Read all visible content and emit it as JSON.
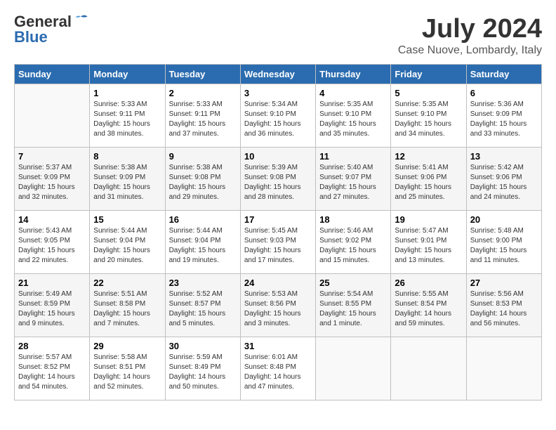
{
  "header": {
    "logo_general": "General",
    "logo_blue": "Blue",
    "month_year": "July 2024",
    "location": "Case Nuove, Lombardy, Italy"
  },
  "days_of_week": [
    "Sunday",
    "Monday",
    "Tuesday",
    "Wednesday",
    "Thursday",
    "Friday",
    "Saturday"
  ],
  "weeks": [
    [
      {
        "day": "",
        "info": ""
      },
      {
        "day": "1",
        "info": "Sunrise: 5:33 AM\nSunset: 9:11 PM\nDaylight: 15 hours\nand 38 minutes."
      },
      {
        "day": "2",
        "info": "Sunrise: 5:33 AM\nSunset: 9:11 PM\nDaylight: 15 hours\nand 37 minutes."
      },
      {
        "day": "3",
        "info": "Sunrise: 5:34 AM\nSunset: 9:10 PM\nDaylight: 15 hours\nand 36 minutes."
      },
      {
        "day": "4",
        "info": "Sunrise: 5:35 AM\nSunset: 9:10 PM\nDaylight: 15 hours\nand 35 minutes."
      },
      {
        "day": "5",
        "info": "Sunrise: 5:35 AM\nSunset: 9:10 PM\nDaylight: 15 hours\nand 34 minutes."
      },
      {
        "day": "6",
        "info": "Sunrise: 5:36 AM\nSunset: 9:09 PM\nDaylight: 15 hours\nand 33 minutes."
      }
    ],
    [
      {
        "day": "7",
        "info": "Sunrise: 5:37 AM\nSunset: 9:09 PM\nDaylight: 15 hours\nand 32 minutes."
      },
      {
        "day": "8",
        "info": "Sunrise: 5:38 AM\nSunset: 9:09 PM\nDaylight: 15 hours\nand 31 minutes."
      },
      {
        "day": "9",
        "info": "Sunrise: 5:38 AM\nSunset: 9:08 PM\nDaylight: 15 hours\nand 29 minutes."
      },
      {
        "day": "10",
        "info": "Sunrise: 5:39 AM\nSunset: 9:08 PM\nDaylight: 15 hours\nand 28 minutes."
      },
      {
        "day": "11",
        "info": "Sunrise: 5:40 AM\nSunset: 9:07 PM\nDaylight: 15 hours\nand 27 minutes."
      },
      {
        "day": "12",
        "info": "Sunrise: 5:41 AM\nSunset: 9:06 PM\nDaylight: 15 hours\nand 25 minutes."
      },
      {
        "day": "13",
        "info": "Sunrise: 5:42 AM\nSunset: 9:06 PM\nDaylight: 15 hours\nand 24 minutes."
      }
    ],
    [
      {
        "day": "14",
        "info": "Sunrise: 5:43 AM\nSunset: 9:05 PM\nDaylight: 15 hours\nand 22 minutes."
      },
      {
        "day": "15",
        "info": "Sunrise: 5:44 AM\nSunset: 9:04 PM\nDaylight: 15 hours\nand 20 minutes."
      },
      {
        "day": "16",
        "info": "Sunrise: 5:44 AM\nSunset: 9:04 PM\nDaylight: 15 hours\nand 19 minutes."
      },
      {
        "day": "17",
        "info": "Sunrise: 5:45 AM\nSunset: 9:03 PM\nDaylight: 15 hours\nand 17 minutes."
      },
      {
        "day": "18",
        "info": "Sunrise: 5:46 AM\nSunset: 9:02 PM\nDaylight: 15 hours\nand 15 minutes."
      },
      {
        "day": "19",
        "info": "Sunrise: 5:47 AM\nSunset: 9:01 PM\nDaylight: 15 hours\nand 13 minutes."
      },
      {
        "day": "20",
        "info": "Sunrise: 5:48 AM\nSunset: 9:00 PM\nDaylight: 15 hours\nand 11 minutes."
      }
    ],
    [
      {
        "day": "21",
        "info": "Sunrise: 5:49 AM\nSunset: 8:59 PM\nDaylight: 15 hours\nand 9 minutes."
      },
      {
        "day": "22",
        "info": "Sunrise: 5:51 AM\nSunset: 8:58 PM\nDaylight: 15 hours\nand 7 minutes."
      },
      {
        "day": "23",
        "info": "Sunrise: 5:52 AM\nSunset: 8:57 PM\nDaylight: 15 hours\nand 5 minutes."
      },
      {
        "day": "24",
        "info": "Sunrise: 5:53 AM\nSunset: 8:56 PM\nDaylight: 15 hours\nand 3 minutes."
      },
      {
        "day": "25",
        "info": "Sunrise: 5:54 AM\nSunset: 8:55 PM\nDaylight: 15 hours\nand 1 minute."
      },
      {
        "day": "26",
        "info": "Sunrise: 5:55 AM\nSunset: 8:54 PM\nDaylight: 14 hours\nand 59 minutes."
      },
      {
        "day": "27",
        "info": "Sunrise: 5:56 AM\nSunset: 8:53 PM\nDaylight: 14 hours\nand 56 minutes."
      }
    ],
    [
      {
        "day": "28",
        "info": "Sunrise: 5:57 AM\nSunset: 8:52 PM\nDaylight: 14 hours\nand 54 minutes."
      },
      {
        "day": "29",
        "info": "Sunrise: 5:58 AM\nSunset: 8:51 PM\nDaylight: 14 hours\nand 52 minutes."
      },
      {
        "day": "30",
        "info": "Sunrise: 5:59 AM\nSunset: 8:49 PM\nDaylight: 14 hours\nand 50 minutes."
      },
      {
        "day": "31",
        "info": "Sunrise: 6:01 AM\nSunset: 8:48 PM\nDaylight: 14 hours\nand 47 minutes."
      },
      {
        "day": "",
        "info": ""
      },
      {
        "day": "",
        "info": ""
      },
      {
        "day": "",
        "info": ""
      }
    ]
  ]
}
